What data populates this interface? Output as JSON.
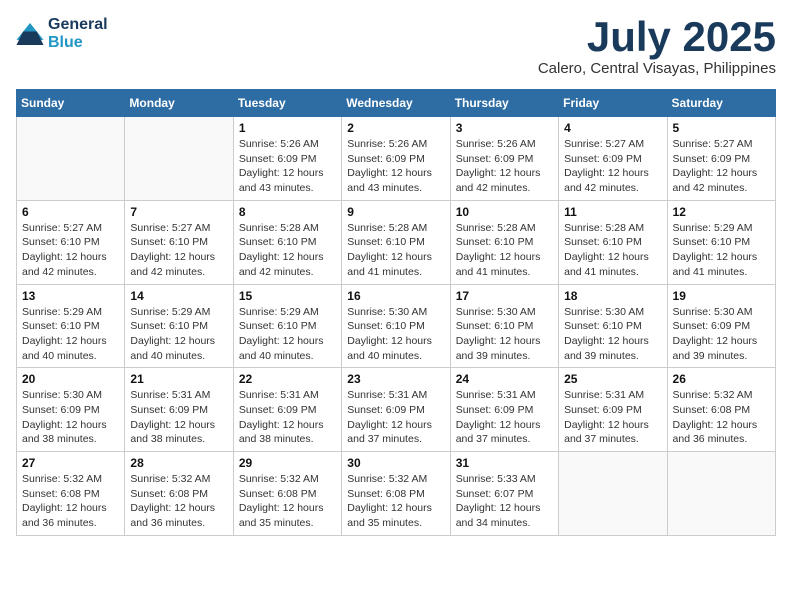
{
  "header": {
    "logo_line1": "General",
    "logo_line2": "Blue",
    "main_title": "July 2025",
    "subtitle": "Calero, Central Visayas, Philippines"
  },
  "weekdays": [
    "Sunday",
    "Monday",
    "Tuesday",
    "Wednesday",
    "Thursday",
    "Friday",
    "Saturday"
  ],
  "weeks": [
    [
      {
        "day": "",
        "sunrise": "",
        "sunset": "",
        "daylight": ""
      },
      {
        "day": "",
        "sunrise": "",
        "sunset": "",
        "daylight": ""
      },
      {
        "day": "1",
        "sunrise": "Sunrise: 5:26 AM",
        "sunset": "Sunset: 6:09 PM",
        "daylight": "Daylight: 12 hours and 43 minutes."
      },
      {
        "day": "2",
        "sunrise": "Sunrise: 5:26 AM",
        "sunset": "Sunset: 6:09 PM",
        "daylight": "Daylight: 12 hours and 43 minutes."
      },
      {
        "day": "3",
        "sunrise": "Sunrise: 5:26 AM",
        "sunset": "Sunset: 6:09 PM",
        "daylight": "Daylight: 12 hours and 42 minutes."
      },
      {
        "day": "4",
        "sunrise": "Sunrise: 5:27 AM",
        "sunset": "Sunset: 6:09 PM",
        "daylight": "Daylight: 12 hours and 42 minutes."
      },
      {
        "day": "5",
        "sunrise": "Sunrise: 5:27 AM",
        "sunset": "Sunset: 6:09 PM",
        "daylight": "Daylight: 12 hours and 42 minutes."
      }
    ],
    [
      {
        "day": "6",
        "sunrise": "Sunrise: 5:27 AM",
        "sunset": "Sunset: 6:10 PM",
        "daylight": "Daylight: 12 hours and 42 minutes."
      },
      {
        "day": "7",
        "sunrise": "Sunrise: 5:27 AM",
        "sunset": "Sunset: 6:10 PM",
        "daylight": "Daylight: 12 hours and 42 minutes."
      },
      {
        "day": "8",
        "sunrise": "Sunrise: 5:28 AM",
        "sunset": "Sunset: 6:10 PM",
        "daylight": "Daylight: 12 hours and 42 minutes."
      },
      {
        "day": "9",
        "sunrise": "Sunrise: 5:28 AM",
        "sunset": "Sunset: 6:10 PM",
        "daylight": "Daylight: 12 hours and 41 minutes."
      },
      {
        "day": "10",
        "sunrise": "Sunrise: 5:28 AM",
        "sunset": "Sunset: 6:10 PM",
        "daylight": "Daylight: 12 hours and 41 minutes."
      },
      {
        "day": "11",
        "sunrise": "Sunrise: 5:28 AM",
        "sunset": "Sunset: 6:10 PM",
        "daylight": "Daylight: 12 hours and 41 minutes."
      },
      {
        "day": "12",
        "sunrise": "Sunrise: 5:29 AM",
        "sunset": "Sunset: 6:10 PM",
        "daylight": "Daylight: 12 hours and 41 minutes."
      }
    ],
    [
      {
        "day": "13",
        "sunrise": "Sunrise: 5:29 AM",
        "sunset": "Sunset: 6:10 PM",
        "daylight": "Daylight: 12 hours and 40 minutes."
      },
      {
        "day": "14",
        "sunrise": "Sunrise: 5:29 AM",
        "sunset": "Sunset: 6:10 PM",
        "daylight": "Daylight: 12 hours and 40 minutes."
      },
      {
        "day": "15",
        "sunrise": "Sunrise: 5:29 AM",
        "sunset": "Sunset: 6:10 PM",
        "daylight": "Daylight: 12 hours and 40 minutes."
      },
      {
        "day": "16",
        "sunrise": "Sunrise: 5:30 AM",
        "sunset": "Sunset: 6:10 PM",
        "daylight": "Daylight: 12 hours and 40 minutes."
      },
      {
        "day": "17",
        "sunrise": "Sunrise: 5:30 AM",
        "sunset": "Sunset: 6:10 PM",
        "daylight": "Daylight: 12 hours and 39 minutes."
      },
      {
        "day": "18",
        "sunrise": "Sunrise: 5:30 AM",
        "sunset": "Sunset: 6:10 PM",
        "daylight": "Daylight: 12 hours and 39 minutes."
      },
      {
        "day": "19",
        "sunrise": "Sunrise: 5:30 AM",
        "sunset": "Sunset: 6:09 PM",
        "daylight": "Daylight: 12 hours and 39 minutes."
      }
    ],
    [
      {
        "day": "20",
        "sunrise": "Sunrise: 5:30 AM",
        "sunset": "Sunset: 6:09 PM",
        "daylight": "Daylight: 12 hours and 38 minutes."
      },
      {
        "day": "21",
        "sunrise": "Sunrise: 5:31 AM",
        "sunset": "Sunset: 6:09 PM",
        "daylight": "Daylight: 12 hours and 38 minutes."
      },
      {
        "day": "22",
        "sunrise": "Sunrise: 5:31 AM",
        "sunset": "Sunset: 6:09 PM",
        "daylight": "Daylight: 12 hours and 38 minutes."
      },
      {
        "day": "23",
        "sunrise": "Sunrise: 5:31 AM",
        "sunset": "Sunset: 6:09 PM",
        "daylight": "Daylight: 12 hours and 37 minutes."
      },
      {
        "day": "24",
        "sunrise": "Sunrise: 5:31 AM",
        "sunset": "Sunset: 6:09 PM",
        "daylight": "Daylight: 12 hours and 37 minutes."
      },
      {
        "day": "25",
        "sunrise": "Sunrise: 5:31 AM",
        "sunset": "Sunset: 6:09 PM",
        "daylight": "Daylight: 12 hours and 37 minutes."
      },
      {
        "day": "26",
        "sunrise": "Sunrise: 5:32 AM",
        "sunset": "Sunset: 6:08 PM",
        "daylight": "Daylight: 12 hours and 36 minutes."
      }
    ],
    [
      {
        "day": "27",
        "sunrise": "Sunrise: 5:32 AM",
        "sunset": "Sunset: 6:08 PM",
        "daylight": "Daylight: 12 hours and 36 minutes."
      },
      {
        "day": "28",
        "sunrise": "Sunrise: 5:32 AM",
        "sunset": "Sunset: 6:08 PM",
        "daylight": "Daylight: 12 hours and 36 minutes."
      },
      {
        "day": "29",
        "sunrise": "Sunrise: 5:32 AM",
        "sunset": "Sunset: 6:08 PM",
        "daylight": "Daylight: 12 hours and 35 minutes."
      },
      {
        "day": "30",
        "sunrise": "Sunrise: 5:32 AM",
        "sunset": "Sunset: 6:08 PM",
        "daylight": "Daylight: 12 hours and 35 minutes."
      },
      {
        "day": "31",
        "sunrise": "Sunrise: 5:33 AM",
        "sunset": "Sunset: 6:07 PM",
        "daylight": "Daylight: 12 hours and 34 minutes."
      },
      {
        "day": "",
        "sunrise": "",
        "sunset": "",
        "daylight": ""
      },
      {
        "day": "",
        "sunrise": "",
        "sunset": "",
        "daylight": ""
      }
    ]
  ]
}
